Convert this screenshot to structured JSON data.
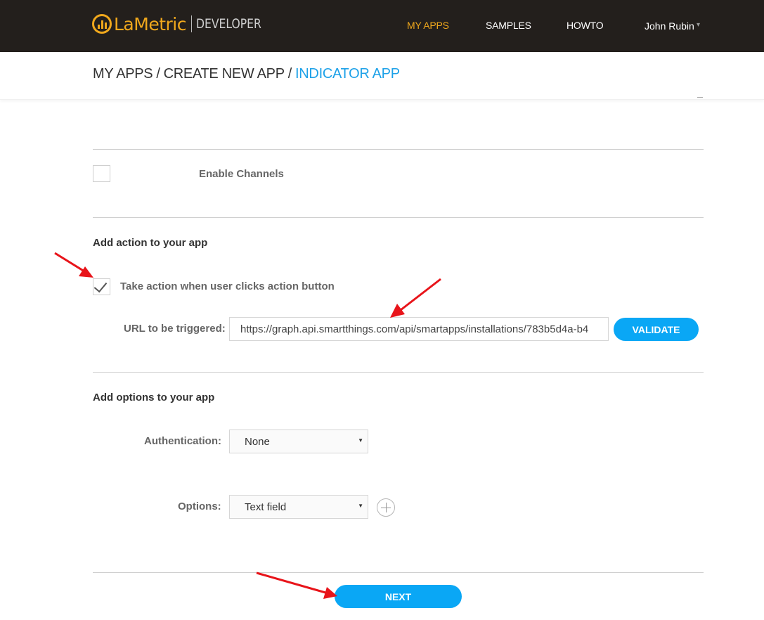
{
  "brand": {
    "logo_text": "LaMetric",
    "logo_sub": "DEVELOPER"
  },
  "nav": {
    "my_apps": "MY APPS",
    "samples": "SAMPLES",
    "howto": "HOWTO",
    "user": "John Rubin",
    "caret": "▾"
  },
  "breadcrumb": {
    "item1": "MY APPS",
    "item2": "CREATE NEW APP",
    "current": "INDICATOR APP",
    "separator": "/"
  },
  "channels": {
    "label": "Enable Channels",
    "checked": false
  },
  "action": {
    "heading": "Add action to your app",
    "checkbox_label": "Take action when user clicks action button",
    "checked": true,
    "url_label": "URL to be triggered:",
    "url_value": "https://graph.api.smartthings.com/api/smartapps/installations/783b5d4a-b4",
    "validate_label": "VALIDATE"
  },
  "options": {
    "heading": "Add options to your app",
    "auth_label": "Authentication:",
    "auth_value": "None",
    "options_label": "Options:",
    "options_value": "Text field",
    "caret": "▼"
  },
  "footer": {
    "next_label": "NEXT"
  },
  "colors": {
    "accent": "#0aa7f5",
    "brand": "#f0a81c",
    "breadcrumb_current": "#1da1e8",
    "annotation_arrow": "#e8141a",
    "topbar": "#231f1c"
  },
  "annotation_icons": [
    "arrow-annotation",
    "arrow-annotation",
    "arrow-annotation"
  ]
}
